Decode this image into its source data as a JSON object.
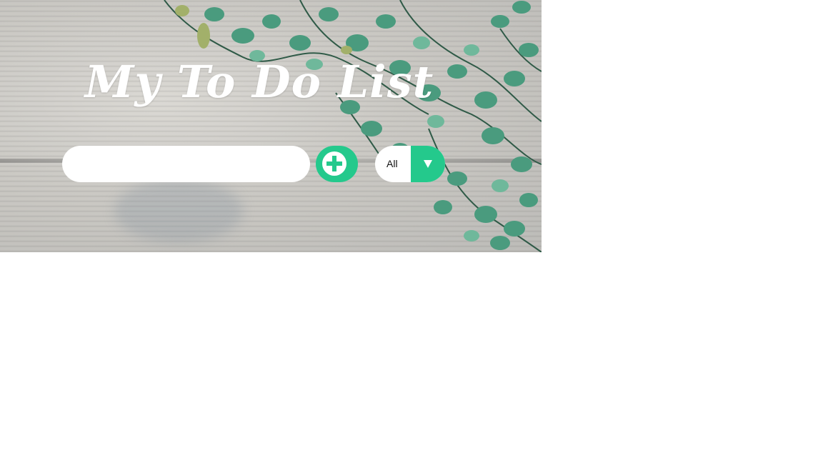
{
  "header": {
    "title": "My To Do List"
  },
  "todo_form": {
    "input_value": "",
    "input_placeholder": "",
    "add_icon": "plus-circle-icon"
  },
  "filter": {
    "selected": "All",
    "arrow_icon": "triangle-down-icon"
  },
  "colors": {
    "accent": "#24c98c",
    "title_text": "#ffffff",
    "page_background": "#ffffff"
  }
}
